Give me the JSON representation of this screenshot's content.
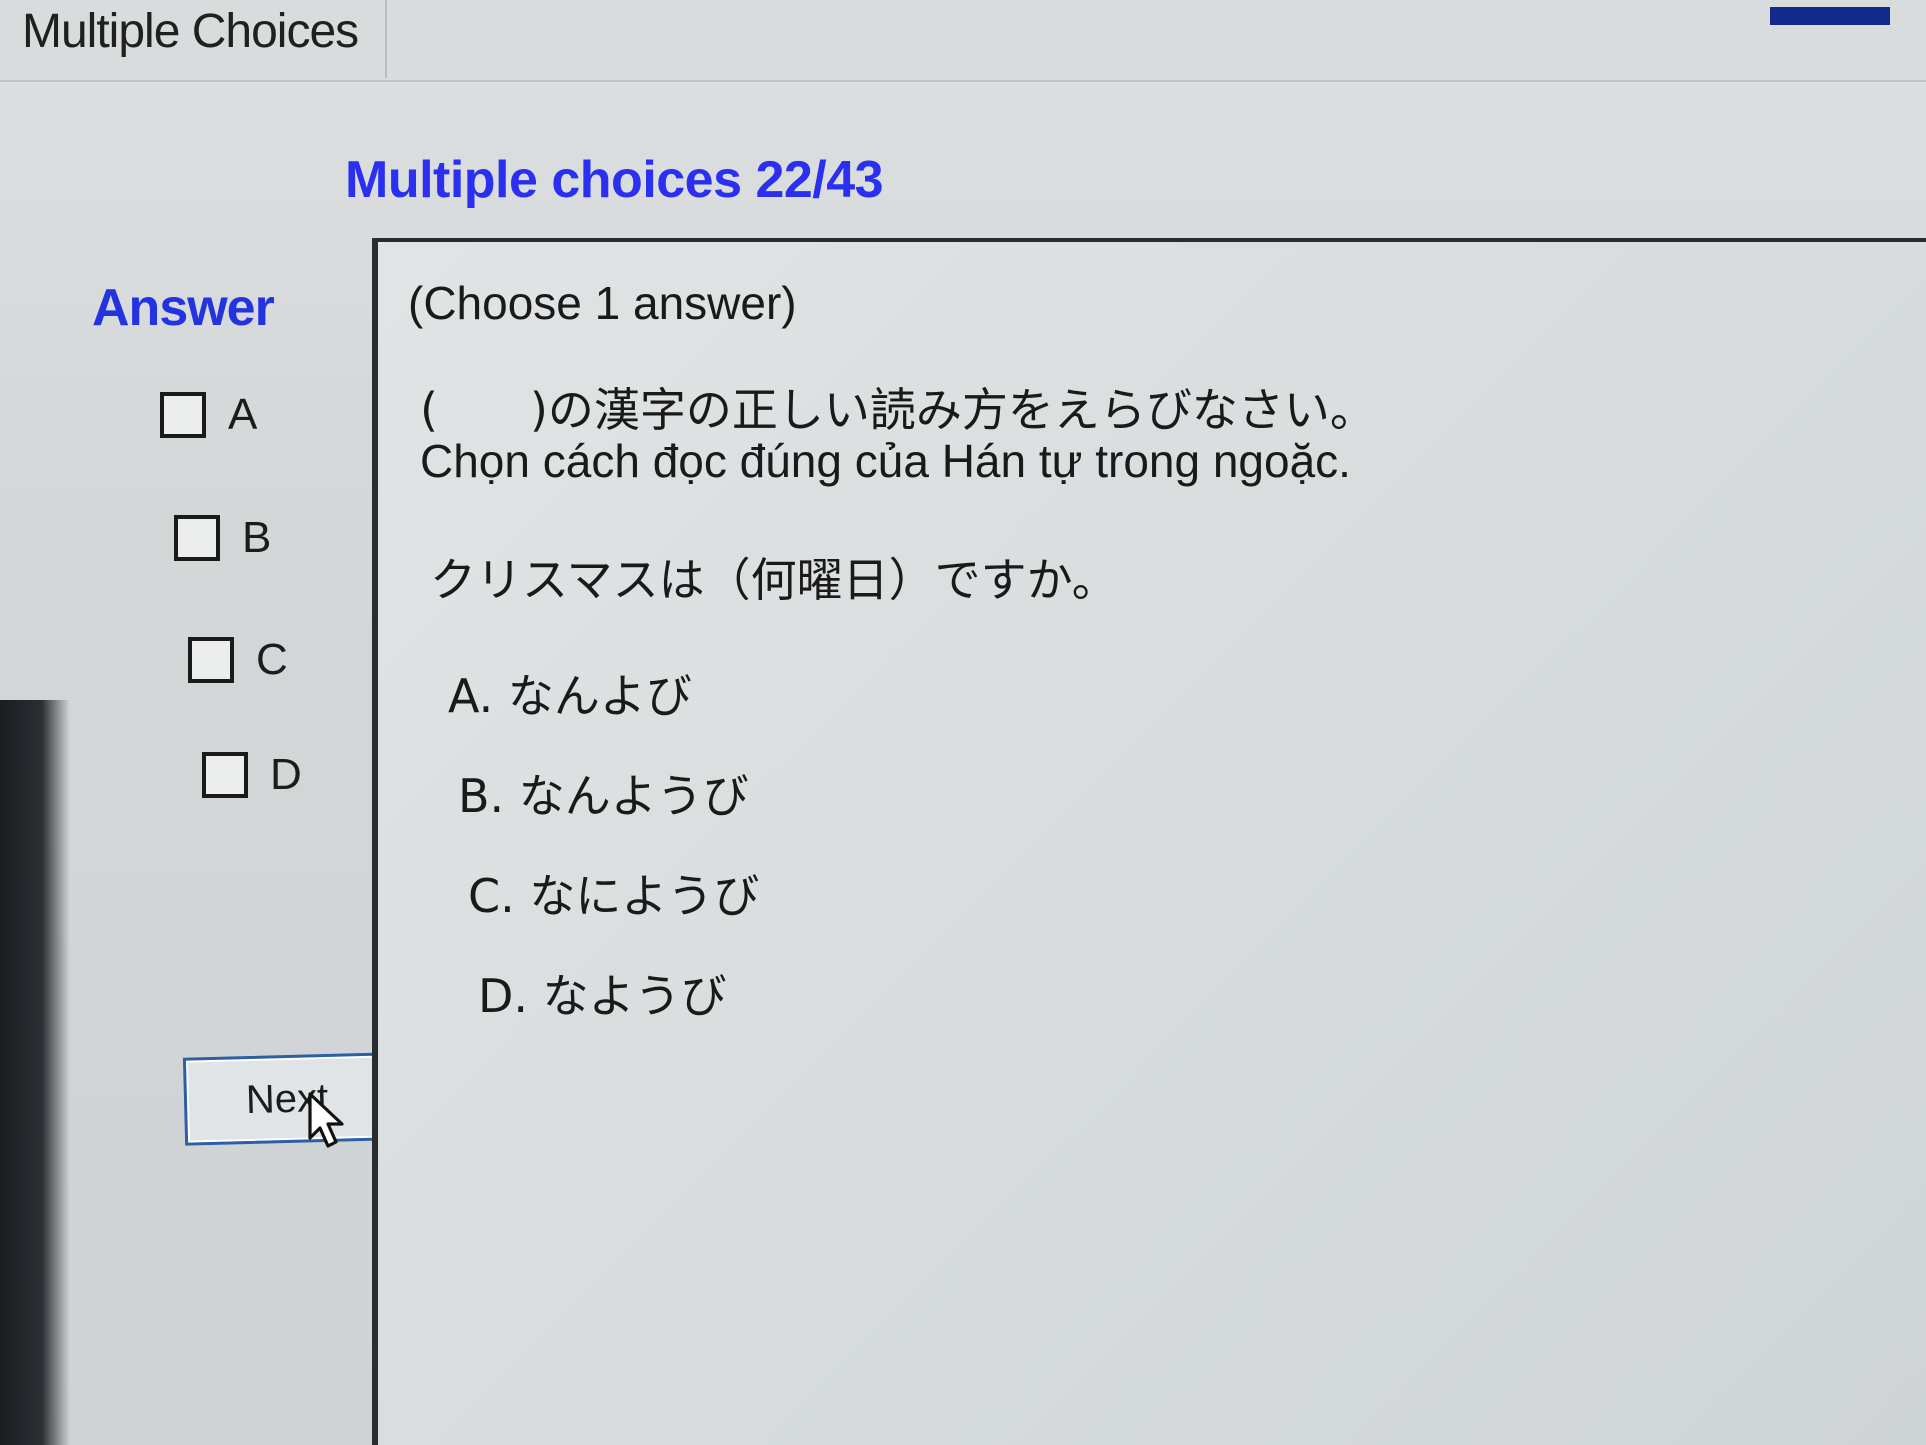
{
  "window": {
    "title": "Multiple Choices"
  },
  "header": {
    "heading": "Multiple choices 22/43"
  },
  "answer_panel": {
    "label": "Answer",
    "options": [
      {
        "letter": "A",
        "checked": false
      },
      {
        "letter": "B",
        "checked": false
      },
      {
        "letter": "C",
        "checked": false
      },
      {
        "letter": "D",
        "checked": false
      }
    ],
    "next_label": "Next"
  },
  "question": {
    "instruction": "(Choose 1 answer)",
    "prompt_ja": "(　　)の漢字の正しい読み方をえらびなさい。",
    "prompt_vi": "Chọn cách đọc đúng của Hán tự trong ngoặc.",
    "stem": "クリスマスは（何曜日）ですか。",
    "choices": [
      "A. なんよび",
      "B. なんようび",
      "C. なにようび",
      "D. なようび"
    ]
  },
  "colors": {
    "heading": "#2b2ff0",
    "answer_label": "#2433e0",
    "next_border": "#2c5fa6"
  }
}
